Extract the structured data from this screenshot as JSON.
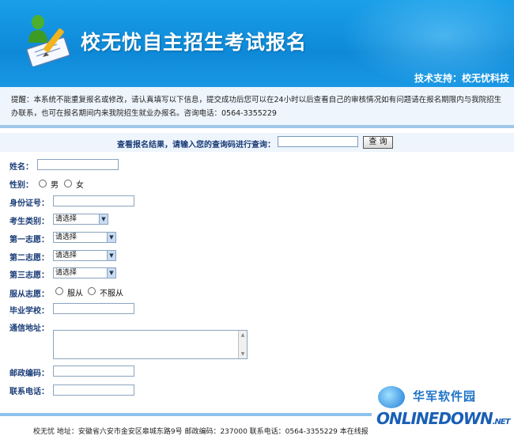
{
  "header": {
    "title": "校无忧自主招生考试报名",
    "support": "技术支持：校无忧科技"
  },
  "notice": {
    "text": "提醒：本系统不能重复报名或修改，请认真填写以下信息，提交成功后您可以在24小时以后查看自己的审核情况如有问题请在报名期限内与我院招生办联系，也可在报名期间内来我院招生就业办报名。咨询电话：0564-3355229"
  },
  "query": {
    "label": "查看报名结果，请输入您的查询码进行查询：",
    "button": "查 询",
    "value": ""
  },
  "form": {
    "name_label": "姓名：",
    "gender_label": "性别：",
    "gender_options": [
      "男",
      "女"
    ],
    "id_label": "身份证号：",
    "category_label": "考生类别：",
    "choice1_label": "第一志愿：",
    "choice2_label": "第二志愿：",
    "choice3_label": "第三志愿：",
    "select_placeholder": "请选择",
    "obey_label": "服从志愿：",
    "obey_options": [
      "服从",
      "不服从"
    ],
    "school_label": "毕业学校：",
    "address_label": "通信地址：",
    "postcode_label": "邮政编码：",
    "phone_label": "联系电话："
  },
  "footer": {
    "text": "校无忧  地址：安徽省六安市金安区皋城东路9号  邮政编码：237000  联系电话：0564-3355229  本在线报"
  },
  "watermark": {
    "top": "华军软件园",
    "bottom": "ONLINEDOWN",
    "suffix": ".NET"
  },
  "colors": {
    "header_bg": "#0d89d8",
    "label": "#1a3c78",
    "notice_bg": "#eef5fc"
  }
}
